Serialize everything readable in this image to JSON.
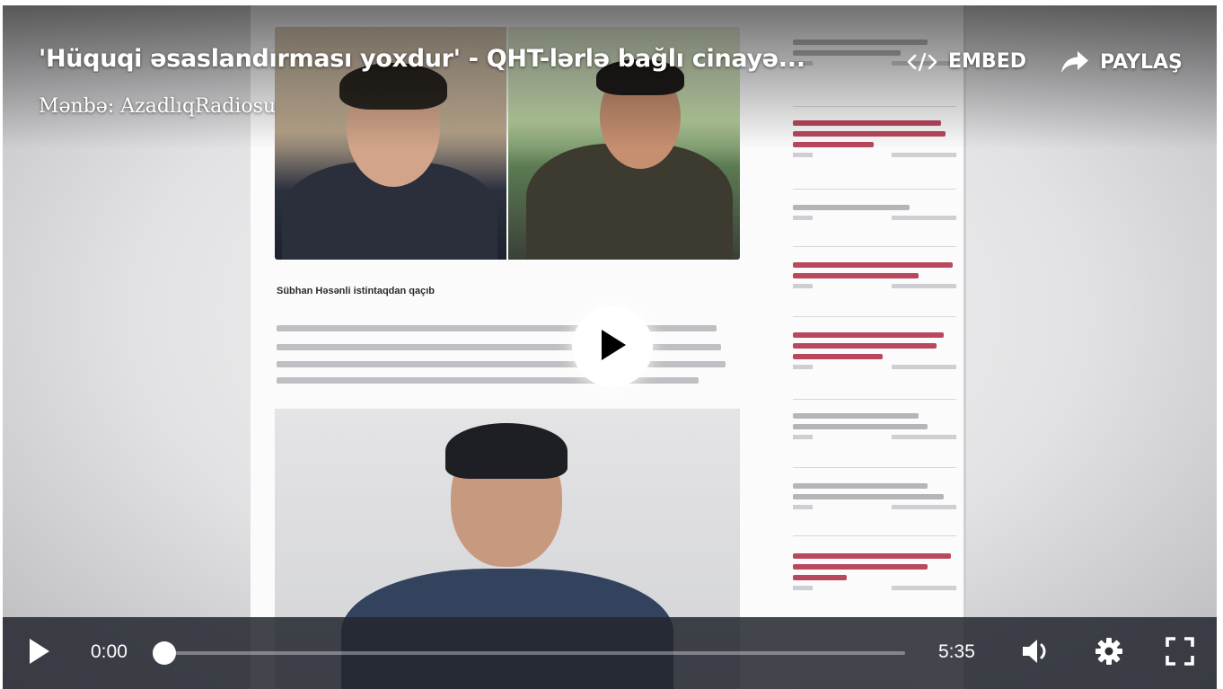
{
  "video": {
    "title": "'Hüquqi əsaslandırması yoxdur' - QHT-lərlə bağlı cinayə...",
    "source": "Mənbə: AzadlıqRadiosu",
    "embed_label": "EMBED",
    "share_label": "PAYLAŞ"
  },
  "poster": {
    "article_heading": "Sübhan Həsənli istintaqdan qaçıb"
  },
  "controls": {
    "current_time": "0:00",
    "duration": "5:35",
    "progress_fraction": 0
  },
  "icons": {
    "embed": "code-icon",
    "share": "share-arrow-icon",
    "big_play": "play-icon",
    "play": "play-icon",
    "volume": "volume-icon",
    "settings": "gear-icon",
    "fullscreen": "fullscreen-icon"
  },
  "colors": {
    "control_bar": "#23262e",
    "sidebar_red": "#a8324a"
  }
}
